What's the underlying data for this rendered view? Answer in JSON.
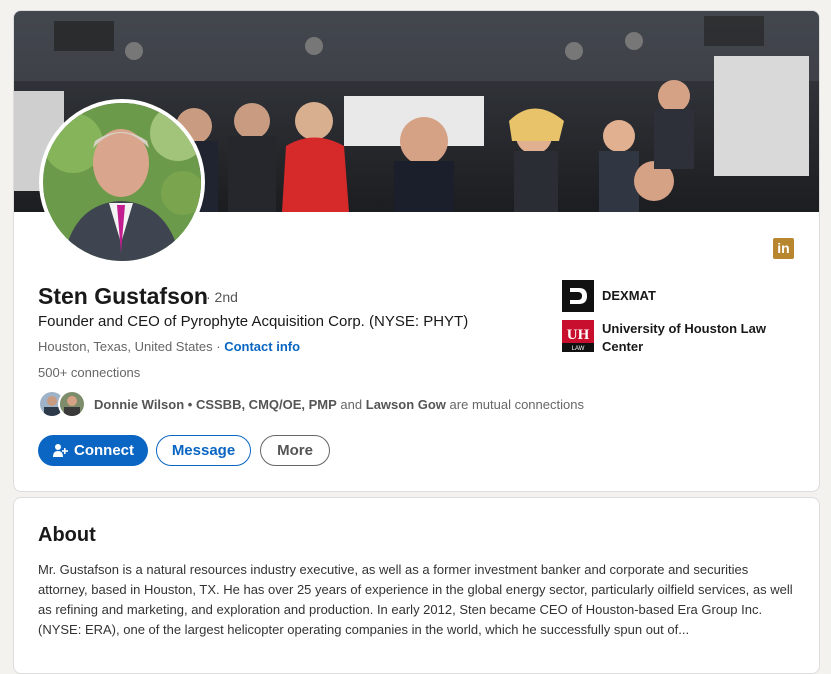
{
  "profile": {
    "name": "Sten Gustafson",
    "degree": "· 2nd",
    "headline": "Founder and CEO of Pyrophyte Acquisition Corp. (NYSE: PHYT)",
    "location": "Houston, Texas, United States ·",
    "contact_label": "Contact info",
    "connections": "500+ connections",
    "mutual": {
      "person1": "Donnie Wilson",
      "person1_suffix": "• CSSBB, CMQ/OE, PMP",
      "joiner": "and",
      "person2": "Lawson Gow",
      "tail": "are mutual connections"
    }
  },
  "actions": {
    "connect_label": "Connect",
    "message_label": "Message",
    "more_label": "More"
  },
  "experience": [
    {
      "name": "DEXMAT",
      "icon": "dexmat-logo"
    },
    {
      "name": "University of Houston Law Center",
      "icon": "uh-law-logo",
      "logo_text": "LAW"
    }
  ],
  "linkedin_badge": "in",
  "about": {
    "title": "About",
    "text": "Mr. Gustafson is a natural resources industry executive, as well as a former investment banker and corporate and securities attorney, based in Houston, TX. He has over 25 years of experience in the global energy sector, particularly oilfield services, as well as refining and marketing, and exploration and production. In early 2012, Sten became CEO of Houston-based Era Group Inc. (NYSE: ERA), one of the largest helicopter operating companies in the world, which he successfully spun out of..."
  },
  "colors": {
    "primary": "#0a66c2",
    "linkedin_gold": "#b8862f",
    "uh_red": "#c8102e"
  }
}
